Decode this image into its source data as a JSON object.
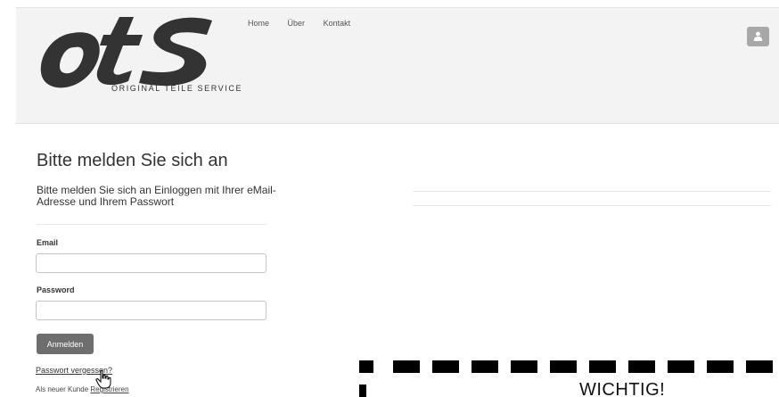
{
  "header": {
    "logo_alt": "OTS",
    "tagline": "ORIGINAL TEILE SERVICE",
    "nav": [
      {
        "label": "Home"
      },
      {
        "label": "Über"
      },
      {
        "label": "Kontakt"
      }
    ],
    "user_icon": "user-icon"
  },
  "login": {
    "title": "Bitte melden Sie sich an",
    "subtitle": "Bitte melden Sie sich an Einloggen mit Ihrer eMail-Adresse und Ihrem Passwort",
    "email_label": "Email",
    "email_value": "",
    "password_label": "Password",
    "password_value": "",
    "submit_label": "Anmelden",
    "forgot_link": "Passwort vergessen?",
    "register_prefix": "Als neuer Kunde",
    "register_link": "Registrieren"
  },
  "notice": {
    "title": "WICHTIG!"
  },
  "colors": {
    "header_bg": "#f3f3f3",
    "button_bg": "#6e6e6e",
    "user_btn_bg": "#a8a8a8",
    "logo": "#333333"
  }
}
